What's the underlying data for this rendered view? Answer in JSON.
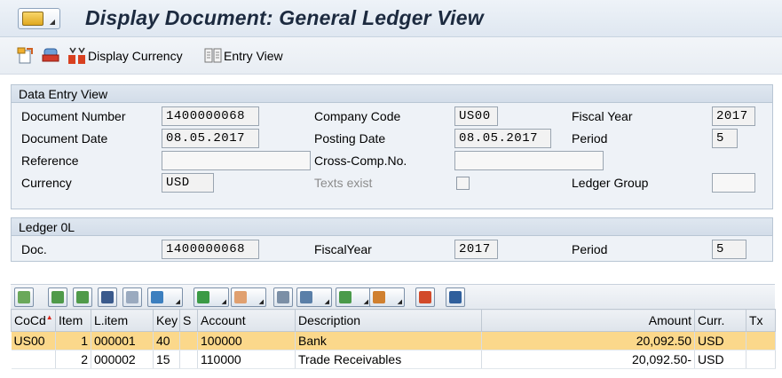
{
  "window": {
    "title": "Display Document: General Ledger View"
  },
  "toolbar": {
    "display_currency": "Display Currency",
    "entry_view": "Entry View"
  },
  "data_entry_view": {
    "title": "Data Entry View",
    "document_number_label": "Document Number",
    "document_number": "1400000068",
    "company_code_label": "Company Code",
    "company_code": "US00",
    "fiscal_year_label": "Fiscal Year",
    "fiscal_year": "2017",
    "document_date_label": "Document Date",
    "document_date": "08.05.2017",
    "posting_date_label": "Posting Date",
    "posting_date": "08.05.2017",
    "period_label": "Period",
    "period": "5",
    "reference_label": "Reference",
    "reference": "",
    "cross_comp_label": "Cross-Comp.No.",
    "cross_comp": "",
    "currency_label": "Currency",
    "currency": "USD",
    "texts_exist_label": "Texts exist",
    "ledger_group_label": "Ledger Group",
    "ledger_group": ""
  },
  "ledger": {
    "title": "Ledger 0L",
    "doc_label": "Doc.",
    "doc": "1400000068",
    "fiscal_year_label": "FiscalYear",
    "fiscal_year": "2017",
    "period_label": "Period",
    "period": "5"
  },
  "grid": {
    "columns": [
      "CoCd",
      "Item",
      "L.item",
      "Key",
      "S",
      "Account",
      "Description",
      "Amount",
      "Curr.",
      "Tx"
    ],
    "rows": [
      {
        "cocd": "US00",
        "item": "1",
        "litem": "000001",
        "key": "40",
        "s": "",
        "account": "100000",
        "description": "Bank",
        "amount": "20,092.50",
        "curr": "USD",
        "tx": ""
      },
      {
        "cocd": "",
        "item": "2",
        "litem": "000002",
        "key": "15",
        "s": "",
        "account": "110000",
        "description": "Trade Receivables",
        "amount": "20,092.50-",
        "curr": "USD",
        "tx": ""
      }
    ]
  },
  "colors": {
    "selected_row": "#fbd88b",
    "title_text": "#1c2a3f"
  }
}
